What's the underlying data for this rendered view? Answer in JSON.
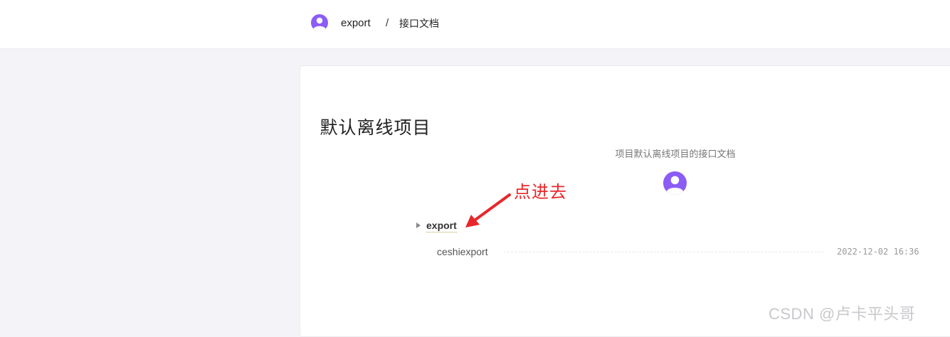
{
  "breadcrumb": {
    "project": "export",
    "separator": "/",
    "page": "接口文档"
  },
  "project": {
    "title": "默认离线项目",
    "description": "项目默认离线项目的接口文档"
  },
  "annotation": {
    "text": "点进去",
    "color": "#e8262a"
  },
  "tree": {
    "folder": {
      "name": "export",
      "expanded": false,
      "toggle_icon": "triangle-right-icon"
    },
    "documents": [
      {
        "name": "ceshiexport",
        "date": "2022-12-02 16:36"
      }
    ]
  },
  "watermark": "CSDN @卢卡平头哥",
  "colors": {
    "avatar": "#8b5cf6",
    "background": "#f4f4f8",
    "card": "#ffffff"
  },
  "icons": {
    "avatar": "user-avatar-icon"
  }
}
